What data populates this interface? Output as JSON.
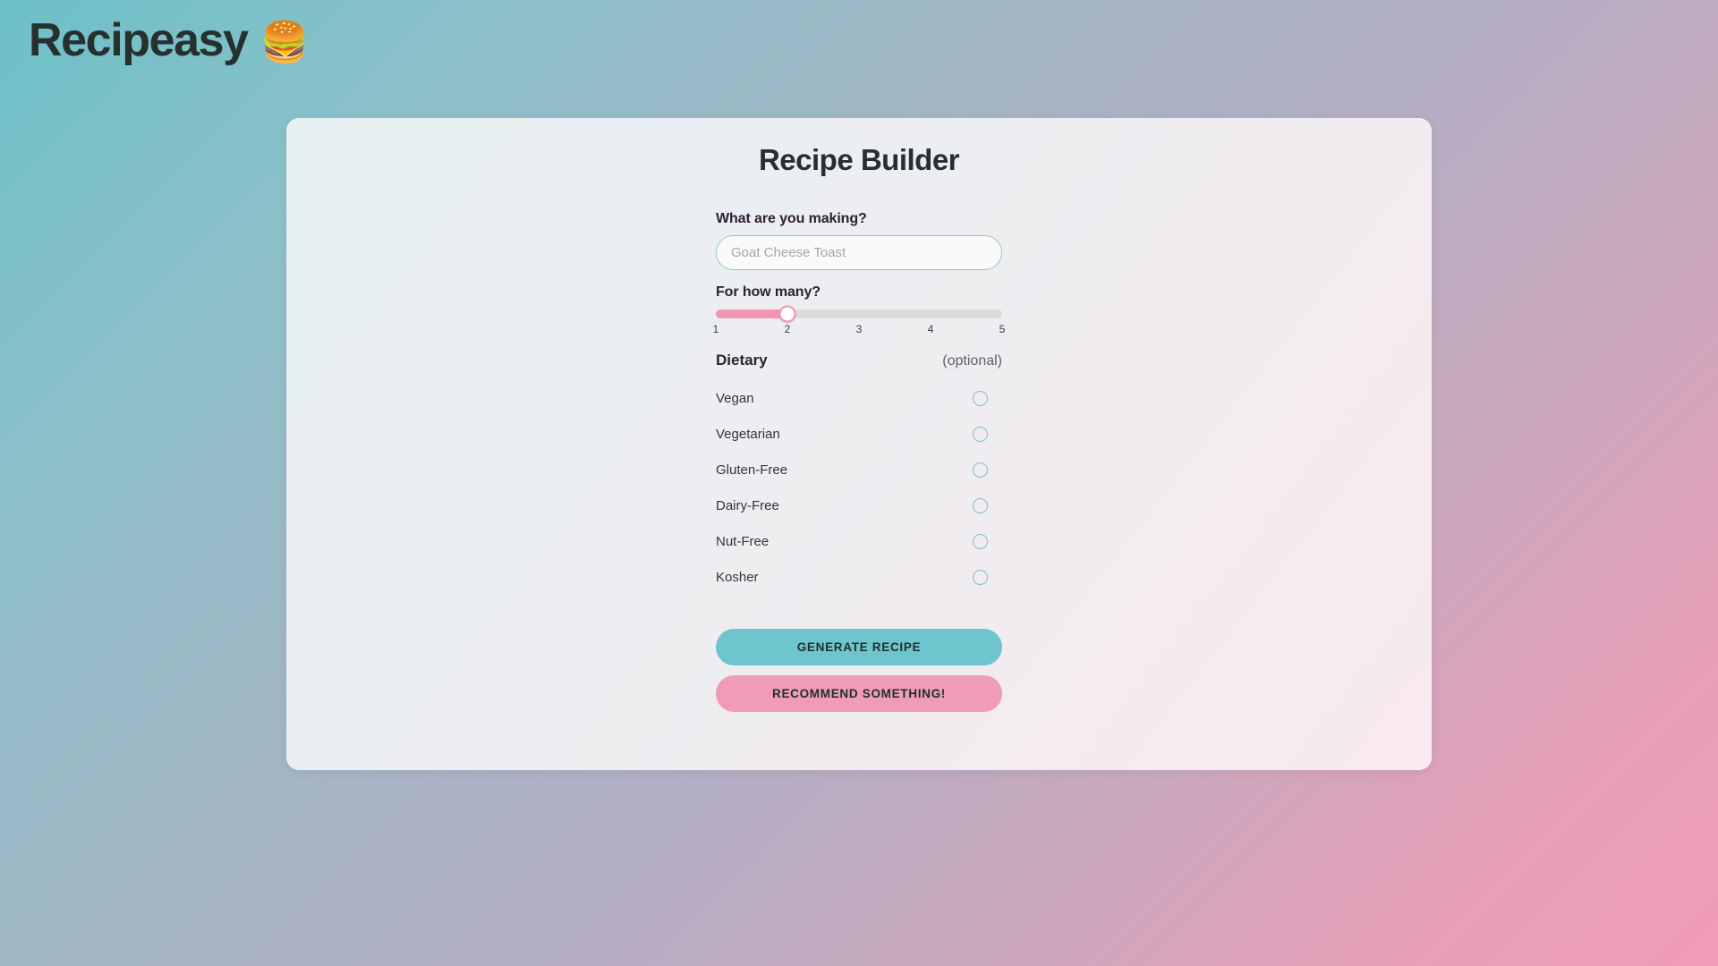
{
  "brand": {
    "name": "Recipeasy",
    "emoji": "🍔",
    "emoji_icon_name": "hamburger-icon"
  },
  "card": {
    "title": "Recipe Builder"
  },
  "form": {
    "dish": {
      "label": "What are you making?",
      "value": "",
      "placeholder": "Goat Cheese Toast"
    },
    "servings": {
      "label": "For how many?",
      "value": 2,
      "min": 1,
      "max": 5,
      "ticks": [
        "1",
        "2",
        "3",
        "4",
        "5"
      ],
      "fill_color": "#f295b4",
      "track_color": "#dcdcdc"
    },
    "dietary": {
      "title": "Dietary",
      "optional_note": "(optional)",
      "accent_color": "#7fc3c8",
      "options": [
        {
          "label": "Vegan",
          "checked": false
        },
        {
          "label": "Vegetarian",
          "checked": false
        },
        {
          "label": "Gluten-Free",
          "checked": false
        },
        {
          "label": "Dairy-Free",
          "checked": false
        },
        {
          "label": "Nut-Free",
          "checked": false
        },
        {
          "label": "Kosher",
          "checked": false
        }
      ]
    }
  },
  "actions": {
    "generate_label": "GENERATE RECIPE",
    "generate_color": "#6ec6cc",
    "recommend_label": "RECOMMEND SOMETHING!",
    "recommend_color": "#f09cb6"
  }
}
